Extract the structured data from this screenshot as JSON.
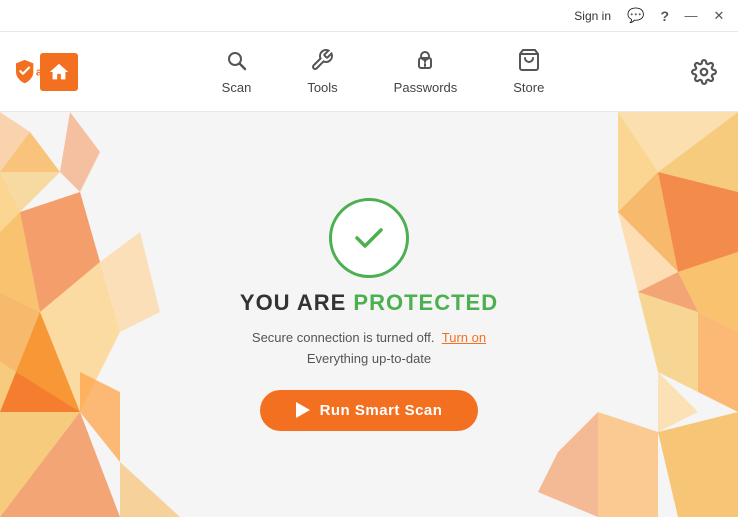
{
  "titlebar": {
    "sign_in": "Sign in",
    "chat_icon": "💬",
    "help_icon": "?",
    "minimize_icon": "—",
    "close_icon": "✕"
  },
  "header": {
    "home_label": "Home",
    "nav_items": [
      {
        "id": "scan",
        "label": "Scan",
        "icon": "🔍"
      },
      {
        "id": "tools",
        "label": "Tools",
        "icon": "🔧"
      },
      {
        "id": "passwords",
        "label": "Passwords",
        "icon": "🔑"
      },
      {
        "id": "store",
        "label": "Store",
        "icon": "🛒"
      }
    ],
    "settings_icon": "⚙"
  },
  "main": {
    "status_prefix": "YOU ARE ",
    "status_highlight": "PROTECTED",
    "secure_conn_text": "Secure connection is turned off.",
    "turn_on_label": "Turn on",
    "up_to_date_text": "Everything up-to-date",
    "scan_button_label": "Run Smart Scan"
  }
}
